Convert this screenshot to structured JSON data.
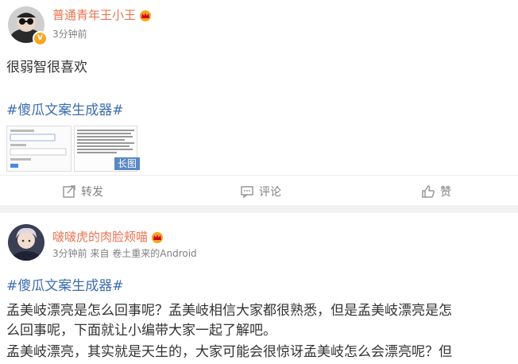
{
  "post1": {
    "username": "普通青年王小王",
    "time": "3分钟前",
    "text": "很弱智很喜欢",
    "hashtag": "#傻瓜文案生成器#",
    "image_badge": "长图",
    "actions": {
      "repost": "转发",
      "comment": "评论",
      "like": "赞"
    }
  },
  "post2": {
    "username": "啵啵虎的肉脸颊喵",
    "meta": "3分钟前 来自 卷土重来的Android",
    "hashtag": "#傻瓜文案生成器#",
    "lines": [
      "孟美岐漂亮是怎么回事呢？孟美岐相信大家都很熟悉，但是孟美岐漂亮是怎",
      "么回事呢，下面就让小编带大家一起了解吧。",
      "孟美岐漂亮，其实就是天生的，大家可能会很惊讶孟美岐怎么会漂亮呢？但"
    ]
  },
  "colors": {
    "username": "#eb7350",
    "hashtag": "#3d6db0",
    "meta": "#808080",
    "badge": "#5a88c4"
  },
  "icons": [
    "avatar-1",
    "avatar-2",
    "verified-badge",
    "crown-icon",
    "repost-icon",
    "comment-icon",
    "like-icon"
  ]
}
